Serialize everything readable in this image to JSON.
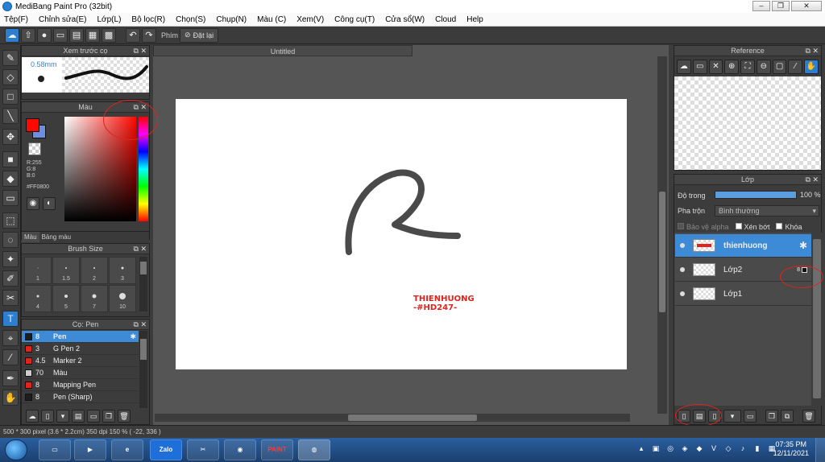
{
  "window": {
    "title": "MediBang Paint Pro (32bit)",
    "min": "0",
    "max": "1",
    "close": "r"
  },
  "menu": [
    "Tệp(F)",
    "Chỉnh sửa(E)",
    "Lớp(L)",
    "Bộ lọc(R)",
    "Chọn(S)",
    "Chụp(N)",
    "Màu (C)",
    "Xem(V)",
    "Công cụ(T)",
    "Cửa sổ(W)",
    "Cloud",
    "Help"
  ],
  "toolbar": {
    "icons": [
      "cloud-icon",
      "export-icon",
      "chat-icon",
      "folder-icon",
      "doc-icon",
      "grid-icon",
      "tiles-icon",
      "undo-icon",
      "redo-icon"
    ],
    "key_label": "Phím",
    "reset_label": "Đặt lại"
  },
  "brush_preview": {
    "title": "Xem trước cọ",
    "size": "0.58mm"
  },
  "color": {
    "title": "Màu",
    "r": "R:255",
    "g": "G:8",
    "b": "B:0",
    "hex": "#FF0800",
    "tab_color": "Màu",
    "tab_palette": "Bảng màu",
    "fg": "#ff0800"
  },
  "brush_size": {
    "title": "Brush Size",
    "sizes": [
      "1",
      "1.5",
      "2",
      "3",
      "4",
      "5",
      "7",
      "10"
    ]
  },
  "brush_list": {
    "title": "Cọ: Pen",
    "items": [
      {
        "size": "8",
        "name": "Pen",
        "color": "#1e1e1e",
        "selected": true
      },
      {
        "size": "3",
        "name": "G Pen 2",
        "color": "#e0231c"
      },
      {
        "size": "4.5",
        "name": "Marker 2",
        "color": "#e0231c"
      },
      {
        "size": "70",
        "name": "Màu",
        "color": "#cccccc"
      },
      {
        "size": "8",
        "name": "Mapping Pen",
        "color": "#e0231c"
      },
      {
        "size": "8",
        "name": "Pen (Sharp)",
        "color": "#1e1e1e"
      }
    ]
  },
  "document": {
    "tab": "Untitled",
    "watermark_line1": "THIENHUONG",
    "watermark_line2": "-#HD247-"
  },
  "reference": {
    "title": "Reference"
  },
  "layers": {
    "title": "Lớp",
    "opacity_label": "Độ trong",
    "opacity_value": "100 %",
    "opacity": 1.0,
    "blend_label": "Pha trộn",
    "blend_value": "Bình thường",
    "protect_alpha": "Bảo vệ alpha",
    "clipping": "Xén bớt",
    "lock": "Khóa",
    "items": [
      {
        "name": "thienhuong",
        "selected": true
      },
      {
        "name": "Lớp2",
        "badge": "8"
      },
      {
        "name": "Lớp1"
      }
    ]
  },
  "status": {
    "text": "500 * 300 pixel  (3.6 * 2.2cm)  350 dpi  150 %  ( -22, 336 )"
  },
  "taskbar": {
    "apps": [
      "Zalo",
      "PAINT"
    ],
    "clock_time": "07:35 PM",
    "clock_date": "12/11/2021"
  }
}
